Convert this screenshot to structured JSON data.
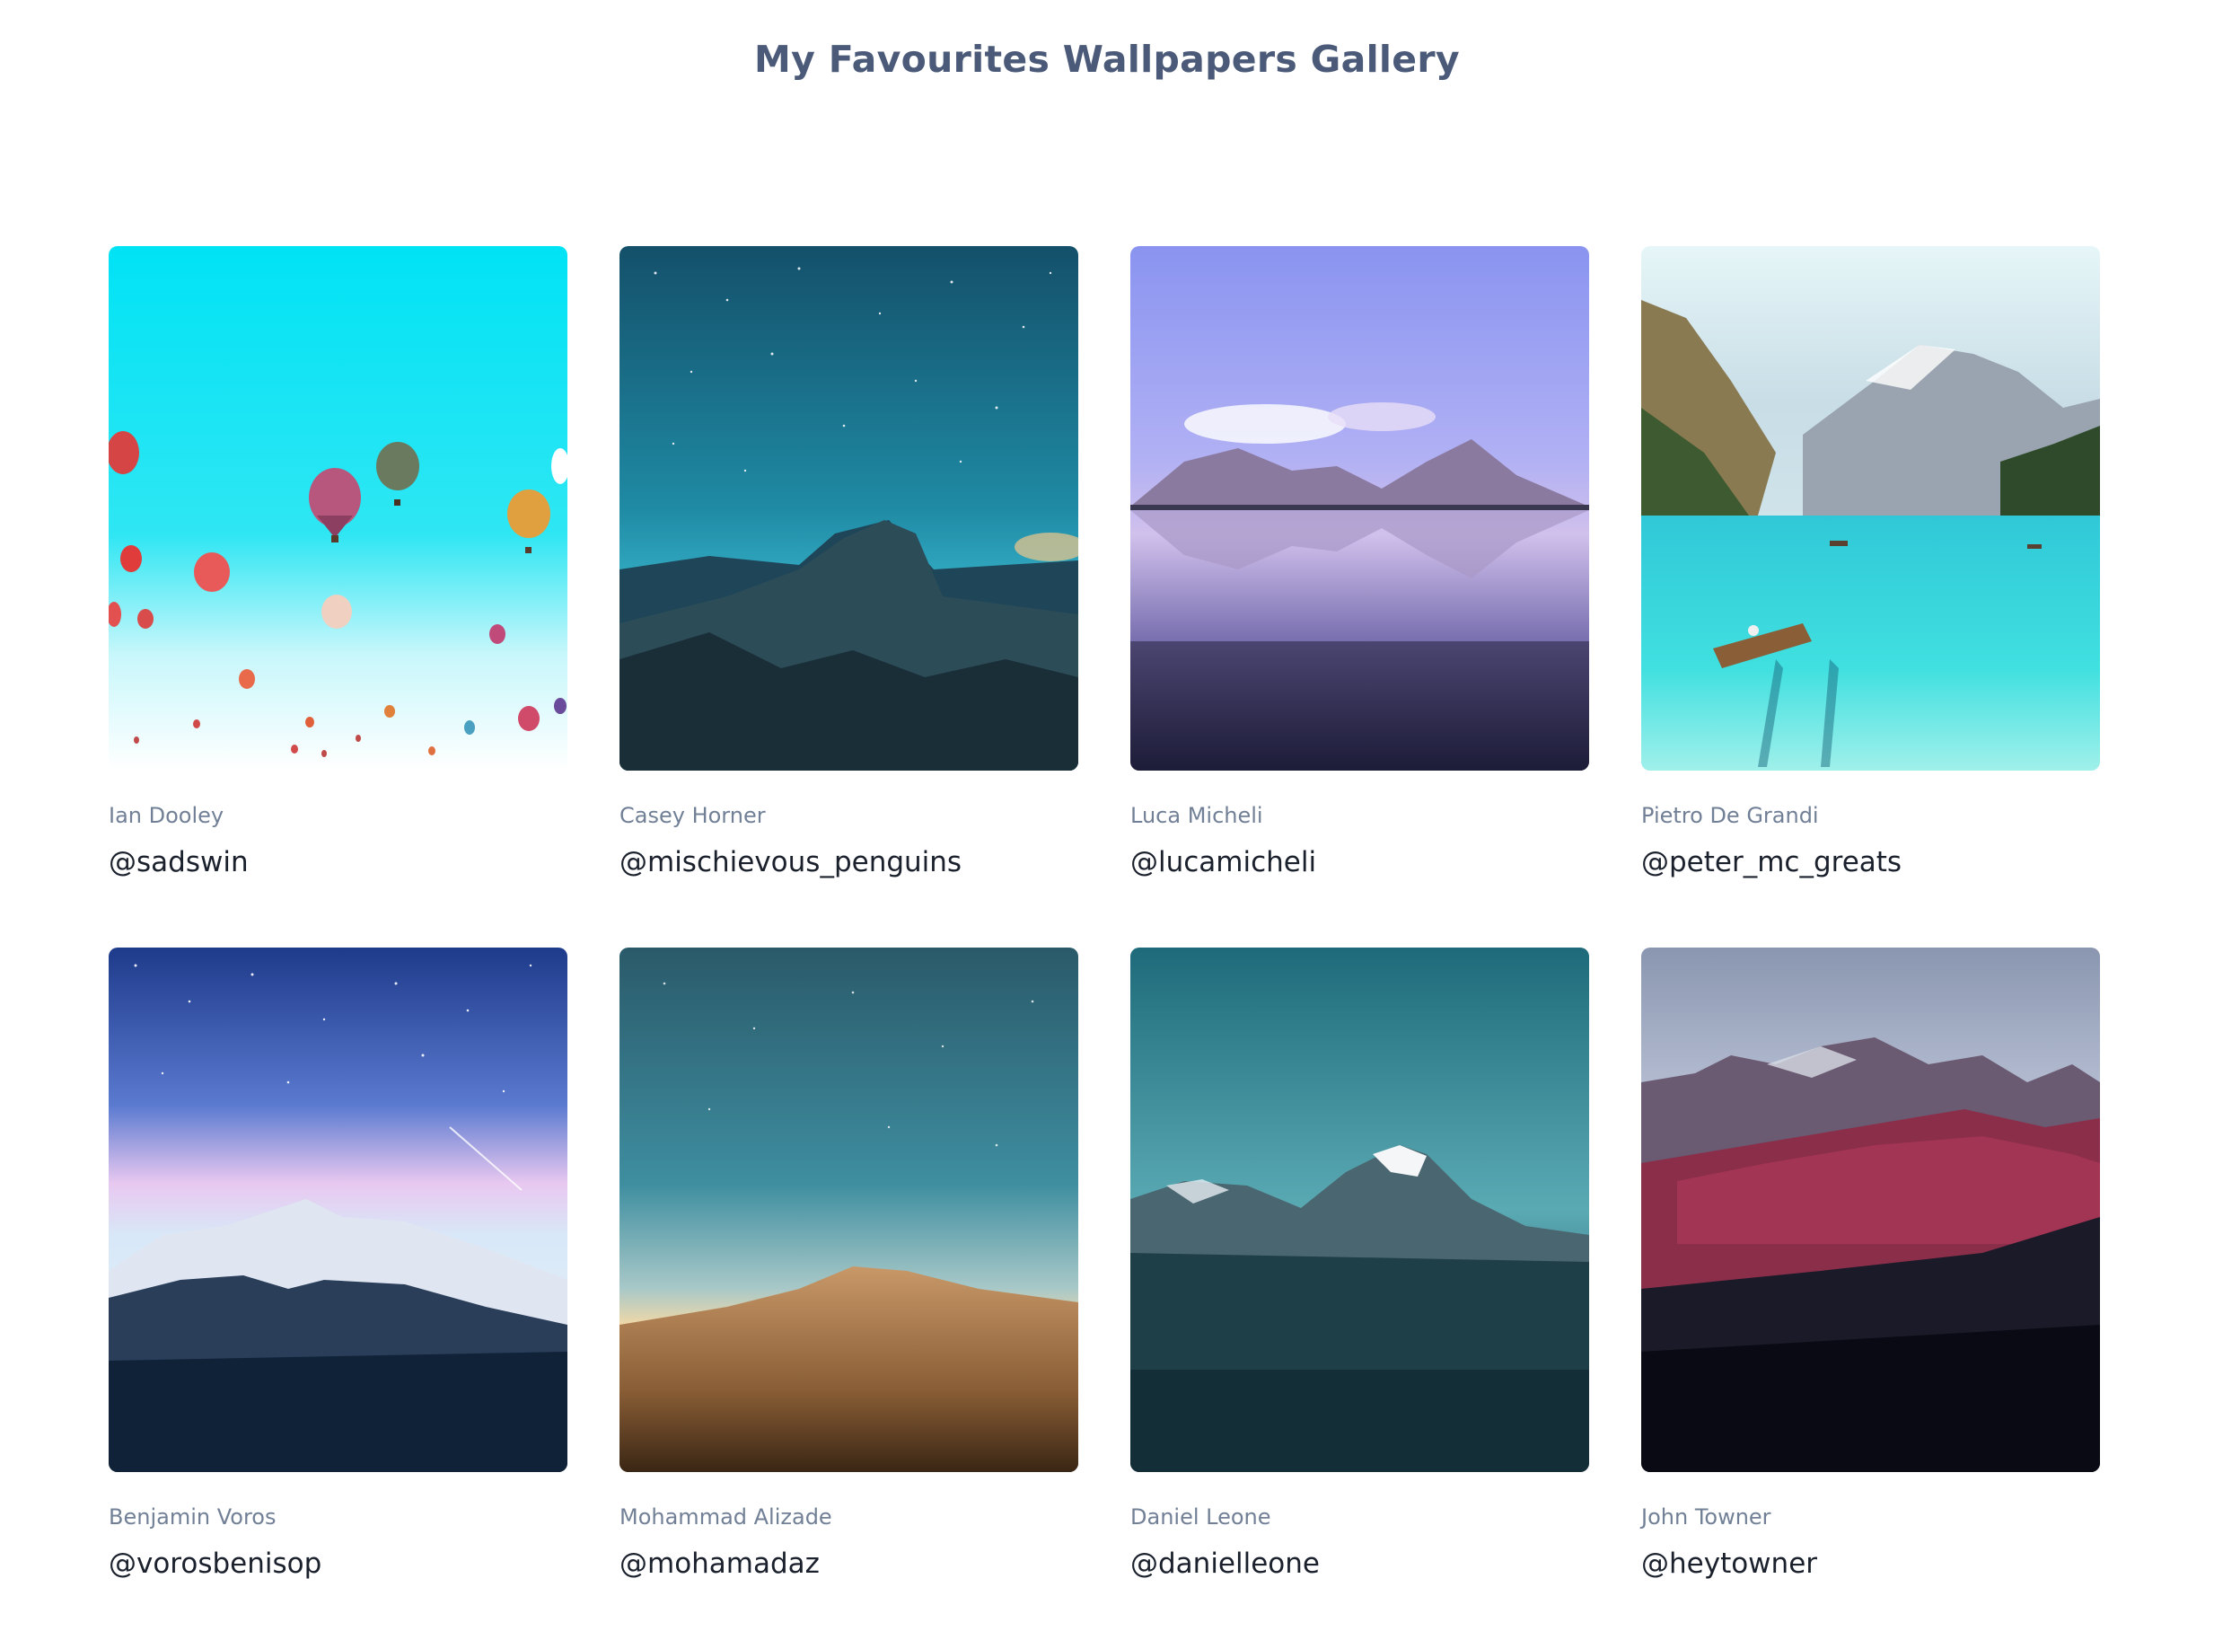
{
  "page": {
    "title": "My Favourites Wallpapers Gallery"
  },
  "gallery": {
    "items": [
      {
        "author": "Ian Dooley",
        "handle": "@sadswin",
        "scene": "hot-air-balloons"
      },
      {
        "author": "Casey Horner",
        "handle": "@mischievous_penguins",
        "scene": "night-mountain-dome"
      },
      {
        "author": "Luca Micheli",
        "handle": "@lucamicheli",
        "scene": "lake-mountain-reflection"
      },
      {
        "author": "Pietro De Grandi",
        "handle": "@peter_mc_greats",
        "scene": "turquoise-lake-boat"
      },
      {
        "author": "Benjamin Voros",
        "handle": "@vorosbenisop",
        "scene": "milky-way-snow-peak"
      },
      {
        "author": "Mohammad Alizade",
        "handle": "@mohamadaz",
        "scene": "desert-hill-starry-sky"
      },
      {
        "author": "Daniel Leone",
        "handle": "@danielleone",
        "scene": "teal-snow-peak"
      },
      {
        "author": "John Towner",
        "handle": "@heytowner",
        "scene": "red-mountain-range"
      }
    ]
  }
}
